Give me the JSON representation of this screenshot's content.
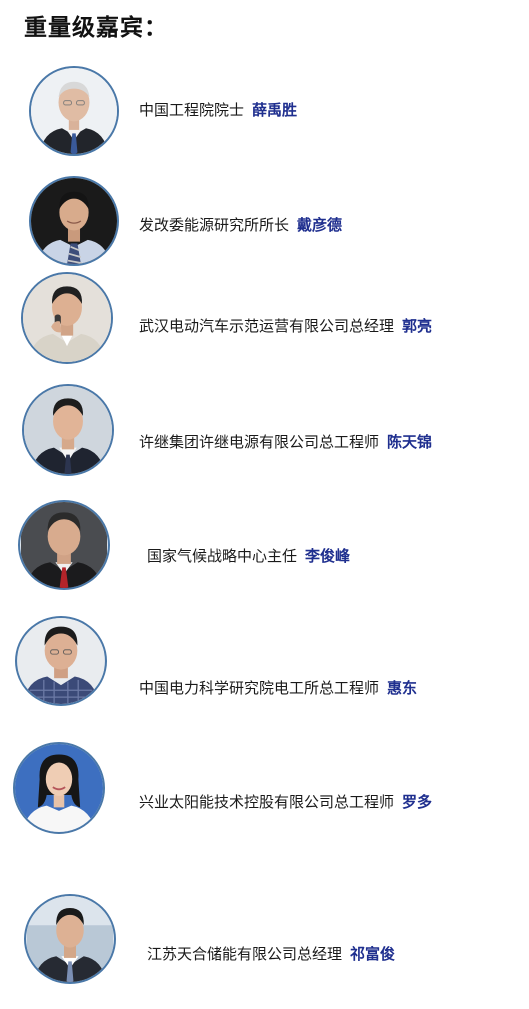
{
  "heading": "重量级嘉宾：",
  "colors": {
    "name_text": "#1f2f8f",
    "title_text": "#1a1a1a",
    "avatar_border": "#4a78a8"
  },
  "guests": [
    {
      "title": "中国工程院院士",
      "name": "薛禹胜",
      "photo": "portrait-elderly-man-suit"
    },
    {
      "title": "发改委能源研究所所长",
      "name": "戴彦德",
      "photo": "portrait-man-dark-background"
    },
    {
      "title": "武汉电动汽车示范运营有限公司总经理",
      "name": "郭亮",
      "photo": "portrait-man-speaking-microphone"
    },
    {
      "title": "许继集团许继电源有限公司总工程师",
      "name": "陈天锦",
      "photo": "portrait-man-suit-grey-background"
    },
    {
      "title": "国家气候战略中心主任",
      "name": "李俊峰",
      "photo": "portrait-man-red-tie"
    },
    {
      "title": "中国电力科学研究院电工所总工程师",
      "name": "惠东",
      "photo": "portrait-man-checked-shirt"
    },
    {
      "title": "兴业太阳能技术控股有限公司总工程师",
      "name": "罗多",
      "photo": "portrait-woman-white-top"
    },
    {
      "title": "江苏天合储能有限公司总经理",
      "name": "祁富俊",
      "photo": "portrait-man-suit-office"
    }
  ]
}
